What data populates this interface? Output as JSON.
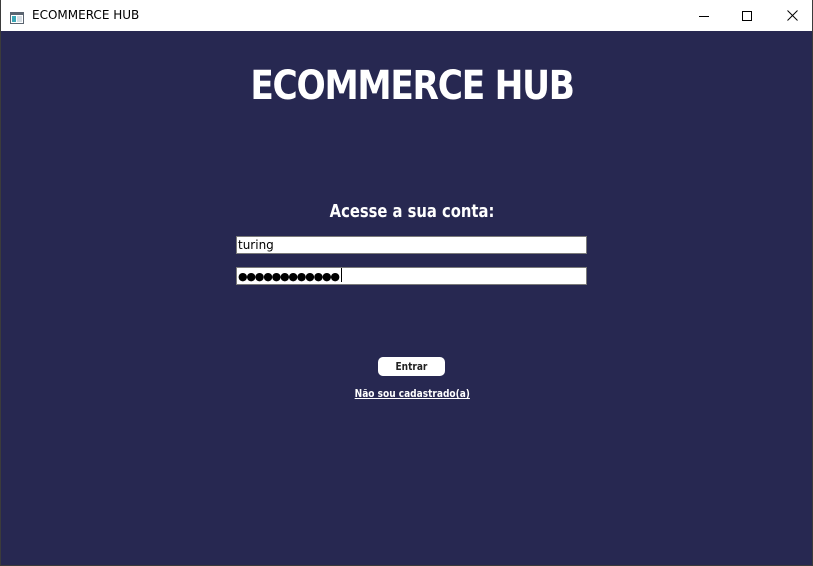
{
  "window": {
    "title": "ECOMMERCE HUB",
    "icon": "app-window-icon",
    "controls": [
      "minimize-icon",
      "maximize-icon",
      "close-icon"
    ]
  },
  "colors": {
    "background": "#272851",
    "text": "#ffffff",
    "field_background": "#ffffff"
  },
  "login": {
    "heading": "ECOMMERCE HUB",
    "subheading": "Acesse a sua conta:",
    "username_value": "turing",
    "password_mask": "●●●●●●●●●●●●",
    "submit_label": "Entrar",
    "register_link": "Não sou cadastrado(a)"
  }
}
